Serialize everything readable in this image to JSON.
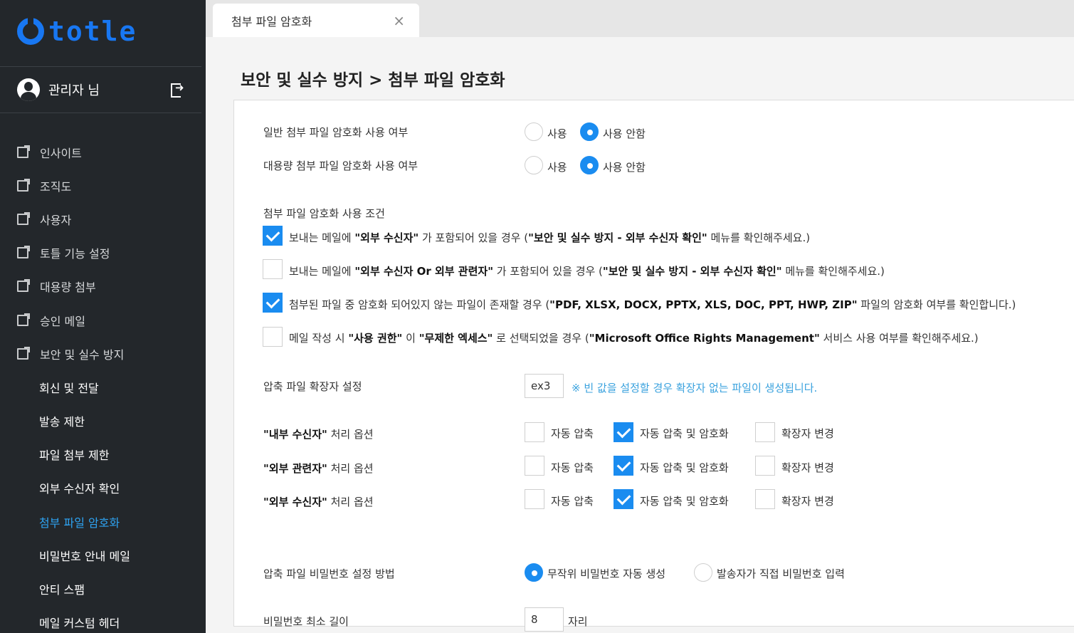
{
  "brand": {
    "name": "totle",
    "color": "#1877f2"
  },
  "user": {
    "name": "관리자 님"
  },
  "menu": {
    "items": [
      {
        "label": "인사이트"
      },
      {
        "label": "조직도"
      },
      {
        "label": "사용자"
      },
      {
        "label": "토틀 기능 설정"
      },
      {
        "label": "대용량 첨부"
      },
      {
        "label": "승인 메일"
      },
      {
        "label": "보안 및 실수 방지"
      }
    ],
    "sub_items": [
      {
        "label": "회신 및 전달"
      },
      {
        "label": "발송 제한"
      },
      {
        "label": "파일 첨부 제한"
      },
      {
        "label": "외부 수신자 확인"
      },
      {
        "label": "첨부 파일 암호화"
      },
      {
        "label": "비밀번호 안내 메일"
      },
      {
        "label": "안티 스팸"
      },
      {
        "label": "메일 커스텀 헤더"
      }
    ]
  },
  "tab": {
    "label": "첨부 파일 암호화",
    "close": "×"
  },
  "page": {
    "title": "보안 및 실수 방지 > 첨부 파일 암호화"
  },
  "settings": {
    "general_encrypt": {
      "label": "일반 첨부 파일 암호화 사용 여부",
      "opt_on": "사용",
      "opt_off": "사용 안함",
      "selected": "사용 안함"
    },
    "large_encrypt": {
      "label": "대용량 첨부 파일 암호화 사용 여부",
      "opt_on": "사용",
      "opt_off": "사용 안함",
      "selected": "사용 안함"
    },
    "conditions": {
      "label": "첨부 파일 암호화 사용 조건",
      "c1": {
        "checked": true,
        "pre": "보내는 메일에 ",
        "b1": "\"외부 수신자\"",
        "mid": " 가 포함되어 있을 경우 (",
        "b2": "\"보안 및 실수 방지 - 외부 수신자 확인\"",
        "post": " 메뉴를 확인해주세요.)"
      },
      "c2": {
        "checked": false,
        "pre": "보내는 메일에 ",
        "b1": "\"외부 수신자 Or 외부 관련자\"",
        "mid": " 가 포함되어 있을 경우 (",
        "b2": "\"보안 및 실수 방지 - 외부 수신자 확인\"",
        "post": " 메뉴를 확인해주세요.)"
      },
      "c3": {
        "checked": true,
        "pre": "첨부된 파일 중 암호화 되어있지 않는 파일이 존재할 경우 (",
        "b1": "\"PDF, XLSX, DOCX, PPTX, XLS, DOC, PPT, HWP, ZIP\"",
        "mid": " 파일의 암호화 여부를 확인합니다.)"
      },
      "c4": {
        "checked": false,
        "pre": "메일 작성 시 ",
        "b1": "\"사용 권한\"",
        "mid": " 이 ",
        "b2": "\"무제한 엑세스\"",
        "mid2": " 로 선택되었을 경우 (",
        "b3": "\"Microsoft Office Rights Management\"",
        "post": " 서비스 사용 여부를 확인해주세요.)"
      }
    },
    "extension": {
      "label": "압축 파일 확장자 설정",
      "value": "ex3",
      "hint": "※ 빈 값을 설정할 경우 확장자 없는 파일이 생성됩니다."
    },
    "options": {
      "opt_auto": "자동 압축",
      "opt_auto_enc": "자동 압축 및 암호화",
      "opt_ext": "확장자 변경",
      "suffix": " 처리 옵션",
      "rows": [
        {
          "name": "\"내부 수신자\"",
          "selected": "자동 압축 및 암호화"
        },
        {
          "name": "\"외부 관련자\"",
          "selected": "자동 압축 및 암호화"
        },
        {
          "name": "\"외부 수신자\"",
          "selected": "자동 압축 및 암호화"
        }
      ]
    },
    "password_method": {
      "label": "압축 파일 비밀번호 설정 방법",
      "opt_random": "무작위 비밀번호 자동 생성",
      "opt_manual": "발송자가 직접 비밀번호 입력",
      "selected": "무작위 비밀번호 자동 생성"
    },
    "password_length": {
      "label": "비밀번호 최소 길이",
      "value": "8",
      "unit": "자리"
    }
  },
  "colors": {
    "sidebar_bg": "#23272b",
    "accent": "#1a8cf0",
    "active_menu": "#2ea3f2",
    "hint": "#3aa2de"
  }
}
